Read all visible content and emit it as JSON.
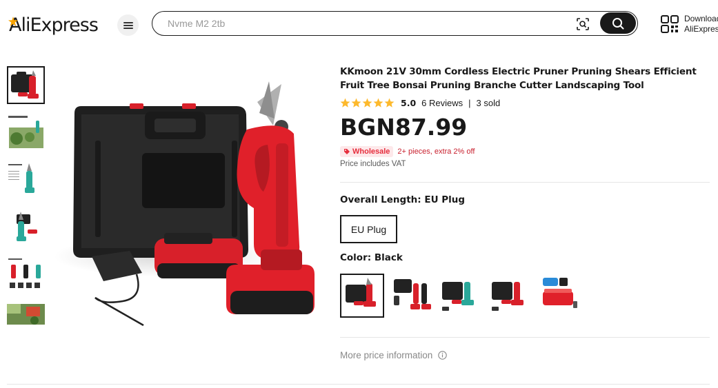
{
  "header": {
    "logo_text": "AliExpress",
    "search_placeholder": "Nvme M2 2tb",
    "download_line1": "Download",
    "download_line2": "AliExpress app"
  },
  "gallery": {
    "thumbnail_count": 6,
    "active_index": 0
  },
  "product": {
    "title": "KKmoon 21V 30mm Cordless Electric Pruner Pruning Shears Efficient Fruit Tree Bonsai Pruning Branche Cutter Landscaping Tool",
    "rating_score": "5.0",
    "stars": 5,
    "reviews": "6 Reviews",
    "separator": "|",
    "sold": "3 sold",
    "price": "BGN87.99",
    "wholesale_badge": "Wholesale",
    "wholesale_text": "2+ pieces, extra 2% off",
    "vat_text": "Price includes VAT",
    "overall_length_label": "Overall Length:",
    "overall_length_value": "EU Plug",
    "plug_option": "EU Plug",
    "color_label": "Color:",
    "color_value": "Black",
    "color_option_count": 5,
    "more_price_info": "More price information"
  },
  "colors": {
    "accent_red": "#e62e3d",
    "tool_red": "#e0202a",
    "dark": "#191919",
    "star_yellow": "#fdb92c"
  }
}
